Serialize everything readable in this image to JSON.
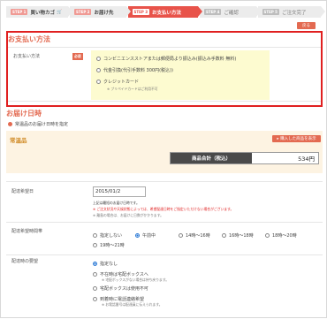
{
  "steps": [
    {
      "badge": "STEP 1",
      "label": "買い物カゴ",
      "icon": "cart-icon",
      "status": "done"
    },
    {
      "badge": "STEP 2",
      "label": "お届け先",
      "status": "done"
    },
    {
      "badge": "STEP 3",
      "label": "お支払い方法",
      "status": "active"
    },
    {
      "badge": "STEP 4",
      "label": "ご確認",
      "status": "todo"
    },
    {
      "badge": "STEP 5",
      "label": "ご注文完了",
      "status": "todo"
    }
  ],
  "back_button": "戻る",
  "payment": {
    "title": "お支払い方法",
    "label": "お支払い方法",
    "required": "必須",
    "options": [
      {
        "label": "コンビニエンスストアまたは郵便局より振込み(振込み手数料 無料)",
        "selected": false
      },
      {
        "label": "代金引換(代引手数料 300円(税込))",
        "selected": false
      },
      {
        "label": "クレジットカード",
        "selected": false
      }
    ],
    "credit_note": "※ プリペイドカードはご利用不可"
  },
  "delivery": {
    "title": "お届け日時",
    "subtitle": "常温品のお届け日時を指定",
    "normal_label": "常温品",
    "items_button": "▸ 購入した商品を表示",
    "total_label": "商品合計（税込）",
    "total_value": "534円",
    "date_label": "配達希望日",
    "date_value": "2015/01/2",
    "date_notes": [
      "上記は最短のお届け日時です。",
      "※ ご注文状況や天候状態によっては、希望配達日時をご指定いただけない場合がございます。",
      "※ 離島の場合は、お届けに日数がかかります。"
    ],
    "time_label": "配達希望時間帯",
    "time_options": [
      {
        "label": "指定しない",
        "selected": false
      },
      {
        "label": "午前中",
        "selected": true
      },
      {
        "label": "14時〜16時",
        "selected": false
      },
      {
        "label": "16時〜18時",
        "selected": false
      },
      {
        "label": "18時〜20時",
        "selected": false
      },
      {
        "label": "19時〜21時",
        "selected": false
      }
    ],
    "absent_label": "配達時の要望",
    "absent_options": [
      {
        "label": "指定なし",
        "selected": true
      },
      {
        "label": "不在時は宅配ボックスへ",
        "selected": false,
        "note": "※ 宅配ボックスがない場合は持ち戻ります。"
      },
      {
        "label": "宅配ボックスは使用不可",
        "selected": false
      },
      {
        "label": "到着時に電話連絡希望",
        "selected": false,
        "note": "※ お電話番号は配達員に伝えられます。"
      }
    ]
  },
  "colors": {
    "accent": "#e8534a",
    "highlight_border": "#e02020",
    "title_orange": "#e36a51",
    "option_box": "#fdfbd0",
    "panel_bg": "#fdf3e2",
    "normal_label": "#d08a25",
    "radio_selected": "#2d7bd6"
  }
}
